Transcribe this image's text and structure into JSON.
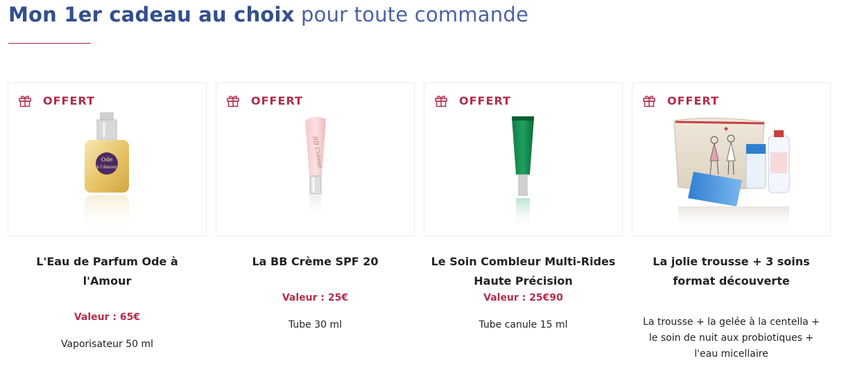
{
  "header": {
    "title_bold": "Mon 1er cadeau au choix",
    "title_light": " pour toute commande"
  },
  "colors": {
    "accent": "#b22d4a",
    "title": "#3b5998"
  },
  "cards": [
    {
      "offer_label": "OFFERT",
      "icon": "gift-icon",
      "name": "L'Eau de Parfum Ode à l'Amour",
      "value": "Valeur : 65€",
      "description": "Vaporisateur 50 ml",
      "bottle_label": "Ode à l'Amour"
    },
    {
      "offer_label": "OFFERT",
      "icon": "gift-icon",
      "name": "La BB Crème SPF 20",
      "value": "Valeur : 25€",
      "description": "Tube 30 ml",
      "tube_label": "BB Crème"
    },
    {
      "offer_label": "OFFERT",
      "icon": "gift-icon",
      "name": "Le Soin Combleur Multi-Rides Haute Précision",
      "value": "Valeur : 25€90",
      "description": "Tube canule 15 ml"
    },
    {
      "offer_label": "OFFERT",
      "icon": "gift-icon",
      "name": "La jolie trousse + 3 soins format découverte",
      "value": "",
      "description": "La trousse + la gelée à la centella + le soin de nuit aux probiotiques + l'eau micellaire"
    }
  ]
}
